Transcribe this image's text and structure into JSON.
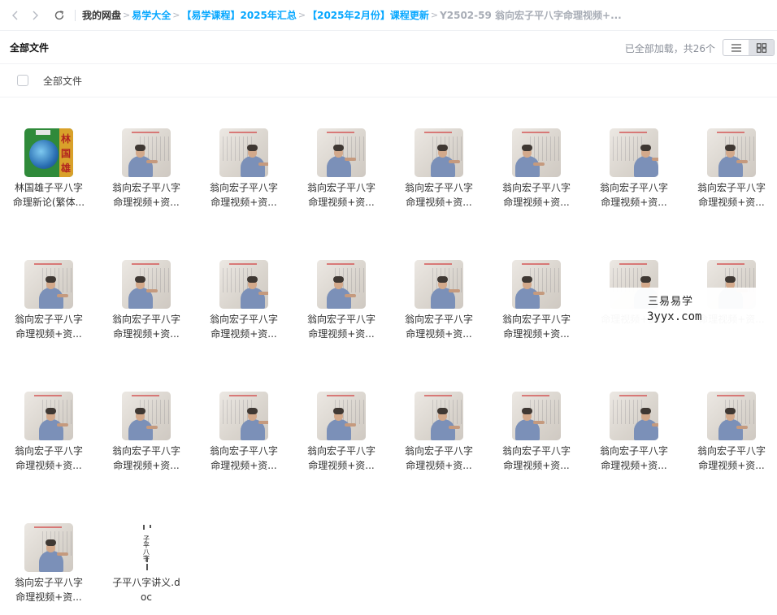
{
  "breadcrumb": {
    "root": "我的网盘",
    "items": [
      "易学大全",
      "【易学课程】2025年汇总",
      "【2025年2月份】课程更新"
    ],
    "current": "Y2502-59 翁向宏子平八字命理视频+...",
    "separator": ">"
  },
  "header": {
    "title": "全部文件",
    "load_status": "已全部加载，共26个"
  },
  "select_row": {
    "label": "全部文件"
  },
  "files": [
    {
      "line1": "林国雄子平八字",
      "line2": "命理新论(繁体...",
      "type": "book"
    },
    {
      "line1": "翁向宏子平八字",
      "line2": "命理视频+资...",
      "type": "video"
    },
    {
      "line1": "翁向宏子平八字",
      "line2": "命理视频+资...",
      "type": "video"
    },
    {
      "line1": "翁向宏子平八字",
      "line2": "命理视频+资...",
      "type": "video"
    },
    {
      "line1": "翁向宏子平八字",
      "line2": "命理视频+资...",
      "type": "video"
    },
    {
      "line1": "翁向宏子平八字",
      "line2": "命理视频+资...",
      "type": "video"
    },
    {
      "line1": "翁向宏子平八字",
      "line2": "命理视频+资...",
      "type": "video"
    },
    {
      "line1": "翁向宏子平八字",
      "line2": "命理视频+资...",
      "type": "video"
    },
    {
      "line1": "翁向宏子平八字",
      "line2": "命理视频+资...",
      "type": "video"
    },
    {
      "line1": "翁向宏子平八字",
      "line2": "命理视频+资...",
      "type": "video"
    },
    {
      "line1": "翁向宏子平八字",
      "line2": "命理视频+资...",
      "type": "video"
    },
    {
      "line1": "翁向宏子平八字",
      "line2": "命理视频+资...",
      "type": "video"
    },
    {
      "line1": "翁向宏子平八字",
      "line2": "命理视频+资...",
      "type": "video"
    },
    {
      "line1": "翁向宏子平八字",
      "line2": "命理视频+资...",
      "type": "video"
    },
    {
      "line1": "",
      "line2": "命理视频+资...",
      "type": "video"
    },
    {
      "line1": "",
      "line2": "命理视频+资...",
      "type": "video"
    },
    {
      "line1": "翁向宏子平八字",
      "line2": "命理视频+资...",
      "type": "video"
    },
    {
      "line1": "翁向宏子平八字",
      "line2": "命理视频+资...",
      "type": "video"
    },
    {
      "line1": "翁向宏子平八字",
      "line2": "命理视频+资...",
      "type": "video"
    },
    {
      "line1": "翁向宏子平八字",
      "line2": "命理视频+资...",
      "type": "video"
    },
    {
      "line1": "翁向宏子平八字",
      "line2": "命理视频+资...",
      "type": "video"
    },
    {
      "line1": "翁向宏子平八字",
      "line2": "命理视频+资...",
      "type": "video"
    },
    {
      "line1": "翁向宏子平八字",
      "line2": "命理视频+资...",
      "type": "video"
    },
    {
      "line1": "翁向宏子平八字",
      "line2": "命理视频+资...",
      "type": "video"
    },
    {
      "line1": "翁向宏子平八字",
      "line2": "命理视频+资...",
      "type": "video"
    },
    {
      "line1": "子平八字讲义.d",
      "line2": "oc",
      "type": "doc"
    }
  ],
  "book_cover_text": [
    "林",
    "国",
    "雄"
  ],
  "doc_cover_text": "子平八字",
  "watermark": {
    "title": "三易易学",
    "url": "3yyx.com"
  },
  "colors": {
    "accent": "#06a7ff",
    "muted": "#a8adb6",
    "shirt": "#7b90b8"
  },
  "icons": [
    "back-arrow-icon",
    "forward-arrow-icon",
    "refresh-icon",
    "list-view-icon",
    "grid-view-icon"
  ]
}
